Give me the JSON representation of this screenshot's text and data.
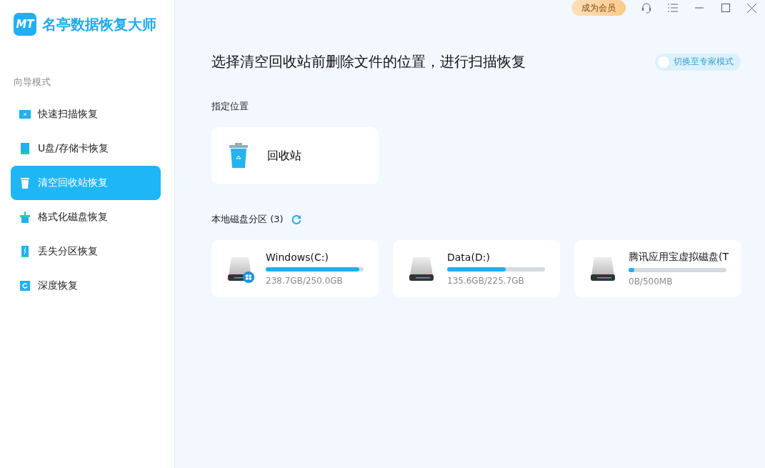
{
  "app": {
    "logo_text": "MT",
    "title": "名亭数据恢复大师"
  },
  "sidebar": {
    "section": "向导模式",
    "items": [
      {
        "kind": "folder",
        "label": "快速扫描恢复",
        "selected": false
      },
      {
        "kind": "card",
        "label": "U盘/存储卡恢复",
        "selected": false
      },
      {
        "kind": "trash",
        "label": "清空回收站恢复",
        "selected": true
      },
      {
        "kind": "format",
        "label": "格式化磁盘恢复",
        "selected": false
      },
      {
        "kind": "partition",
        "label": "丢失分区恢复",
        "selected": false
      },
      {
        "kind": "deep",
        "label": "深度恢复",
        "selected": false
      }
    ]
  },
  "topbar": {
    "member_button": "成为会员"
  },
  "heading": "选择清空回收站前删除文件的位置，进行扫描恢复",
  "expert_toggle": {
    "label": "切换至专家模式",
    "on": false
  },
  "location_section": {
    "title": "指定位置",
    "items": [
      {
        "label": "回收站"
      }
    ]
  },
  "disk_section": {
    "title": "本地磁盘分区 (3)",
    "disks": [
      {
        "kind": "windows",
        "name": "Windows(C:)",
        "level": 0.955,
        "usage": "238.7GB/250.0GB"
      },
      {
        "kind": "plain",
        "name": "Data(D:)",
        "level": 0.6,
        "usage": "135.6GB/225.7GB"
      },
      {
        "kind": "plain",
        "name": "腾讯应用宝虚拟磁盘(T",
        "level": 0.06,
        "usage": "0B/500MB"
      }
    ]
  }
}
